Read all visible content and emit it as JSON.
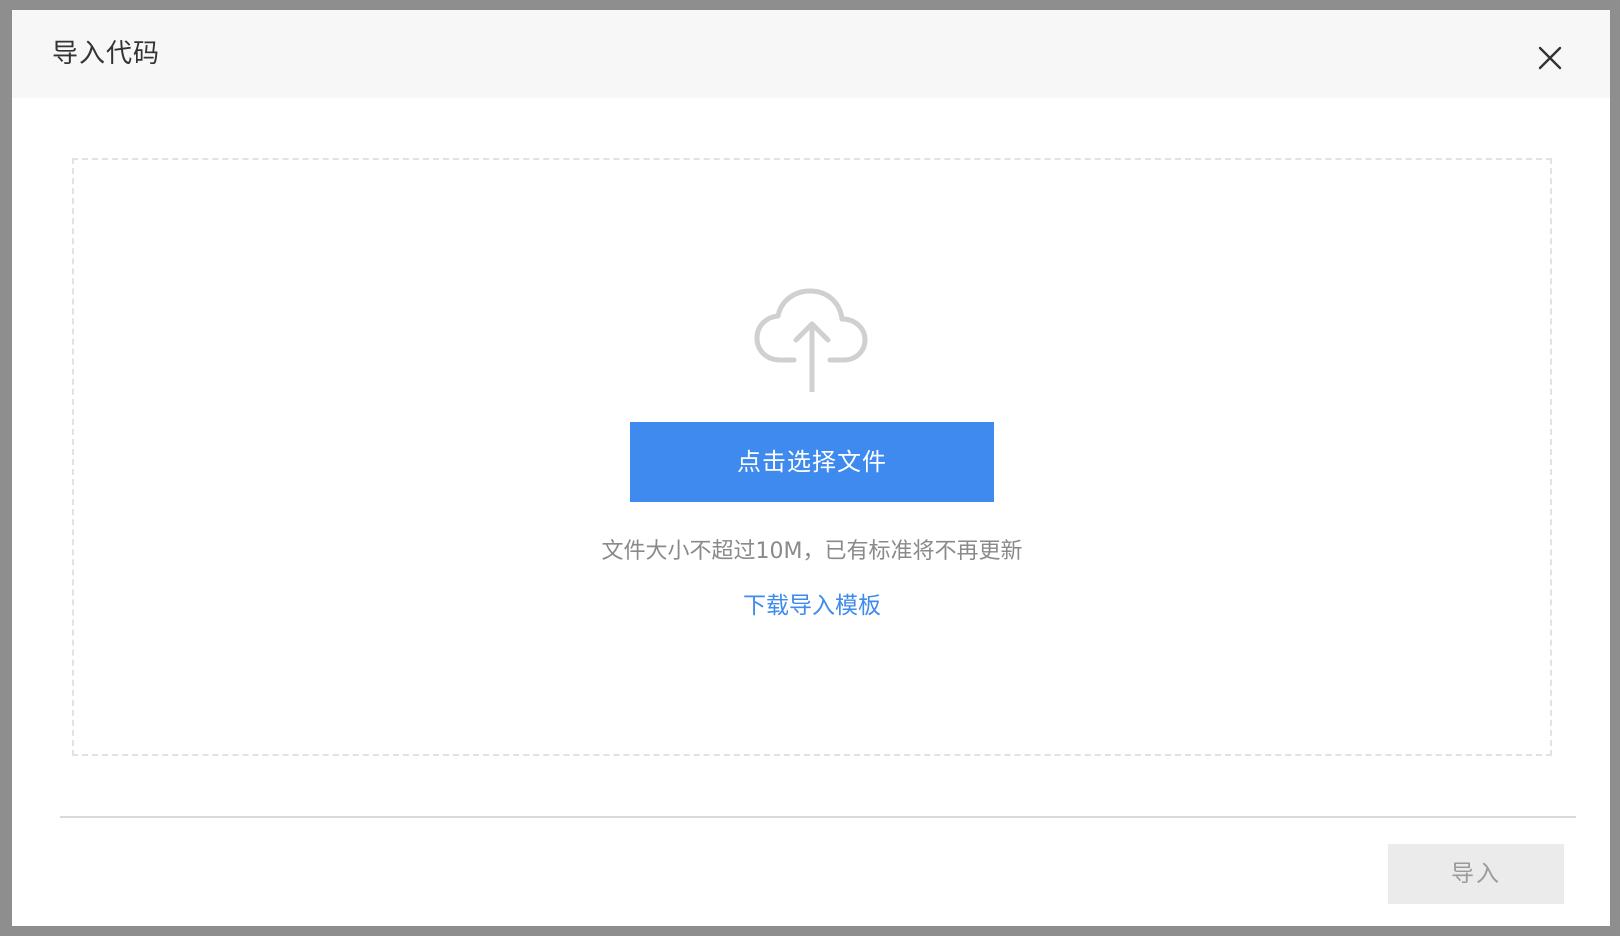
{
  "dialog": {
    "title": "导入代码",
    "close_icon": "close-icon"
  },
  "upload": {
    "icon": "cloud-upload-icon",
    "select_button_label": "点击选择文件",
    "hint": "文件大小不超过10M，已有标准将不再更新",
    "template_link_label": "下载导入模板"
  },
  "footer": {
    "import_button_label": "导入",
    "import_button_disabled": true
  },
  "colors": {
    "accent": "#3f8aee",
    "overlay": "#8e8e8e",
    "header_bg": "#f7f7f7",
    "dashed_border": "#e2e2e2",
    "disabled_button_bg": "#ebebeb"
  }
}
